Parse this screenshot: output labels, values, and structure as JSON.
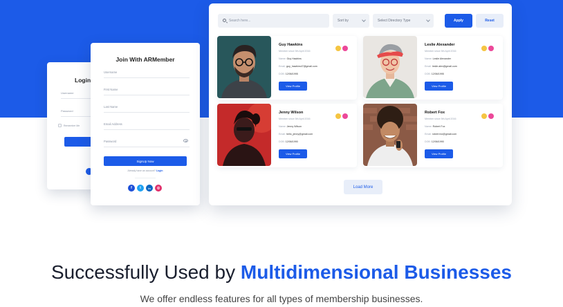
{
  "login_card": {
    "title": "Login",
    "fields": [
      "Username",
      "Password"
    ],
    "remember_label": "Remember Me"
  },
  "join_card": {
    "title": "Join With ARMember",
    "fields": [
      "Username",
      "First Name",
      "Last Name",
      "Email Address",
      "Password"
    ],
    "signup_label": "SignUp Now",
    "already_text": "Already have an account?",
    "login_link": "Login",
    "social_icons": [
      "facebook-icon",
      "twitter-icon",
      "linkedin-icon",
      "instagram-icon"
    ]
  },
  "directory": {
    "search_placeholder": "Search here...",
    "sort_label": "Sort by",
    "type_label": "Select Directory Type",
    "apply_label": "Apply",
    "reset_label": "Reset",
    "load_more_label": "Load More",
    "members": [
      {
        "name": "Guy Hawkins",
        "since": "Member since 5th April 2016",
        "name_label": "Name:",
        "name_value": "Guy Hawkins",
        "email_label": "Email:",
        "email_value": "guy_hawkins47@gmail.com",
        "dob_label": "DOB:",
        "dob_value": "12/06/1995",
        "button": "View Profile"
      },
      {
        "name": "Leslie Alexander",
        "since": "Member since 5th April 2016",
        "name_label": "Name:",
        "name_value": "Leslie Alexander",
        "email_label": "Email:",
        "email_value": "leslie.alex@gmail.com",
        "dob_label": "DOB:",
        "dob_value": "12/06/1995",
        "button": "View Profile"
      },
      {
        "name": "Jenny Wilson",
        "since": "Member since 5th April 2016",
        "name_label": "Name:",
        "name_value": "Jenny Wilson",
        "email_label": "Email:",
        "email_value": "hello_jenny@gmail.com",
        "dob_label": "DOB:",
        "dob_value": "12/06/1990",
        "button": "View Profile"
      },
      {
        "name": "Robert Fox",
        "since": "Member since 5th April 2016",
        "name_label": "Name:",
        "name_value": "Robert Fox",
        "email_label": "Email:",
        "email_value": "robert.fox@gmail.com",
        "dob_label": "DOB:",
        "dob_value": "12/06/1990",
        "button": "View Profile"
      }
    ]
  },
  "headline": {
    "prefix": "Successfully Used by ",
    "accent": "Multidimensional Businesses",
    "subline": "We offer endless features for all types of membership businesses."
  },
  "colors": {
    "brand_blue": "#1c5be8",
    "badge_gold": "#f5c542",
    "badge_pink": "#ec4899"
  }
}
